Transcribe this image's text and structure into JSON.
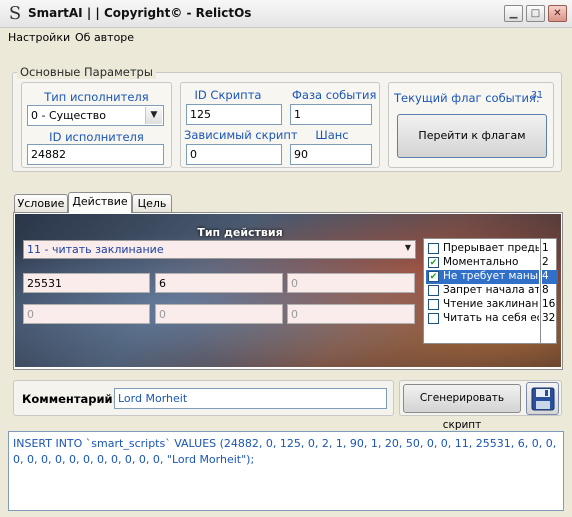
{
  "window": {
    "app_icon": "S",
    "title": "SmartAI | | Copyright© - RelictOs",
    "minimize": "▁",
    "maximize": "□",
    "close": "✕"
  },
  "menu": {
    "settings": "Настройки",
    "about": "Об авторе"
  },
  "basic_params": {
    "group_title": "Основные Параметры",
    "executor_type_label": "Тип исполнителя",
    "executor_type_value": "0 - Существо",
    "executor_id_label": "ID исполнителя",
    "executor_id_value": "24882",
    "script_id_label": "ID Скрипта",
    "script_id_value": "125",
    "event_phase_label": "Фаза события",
    "event_phase_value": "1",
    "dependent_script_label": "Зависимый скрипт",
    "dependent_script_value": "0",
    "chance_label": "Шанс",
    "chance_value": "90",
    "current_flag_label": "Текущий флаг события:",
    "current_flag_value": "31",
    "go_to_flags_button": "Перейти к флагам"
  },
  "tabs": {
    "condition": "Условие",
    "action": "Действие",
    "target": "Цель"
  },
  "action_tab": {
    "action_type_title": "Тип действия",
    "action_type_value": "11 - читать заклинание",
    "params": [
      "25531",
      "6",
      "0",
      "0",
      "0",
      "0"
    ],
    "flags": [
      {
        "label": "Прерывает преды",
        "value": "1",
        "checked": false,
        "selected": false
      },
      {
        "label": "Моментально",
        "value": "2",
        "checked": true,
        "selected": false
      },
      {
        "label": "Не требует маны",
        "value": "4",
        "checked": true,
        "selected": true
      },
      {
        "label": "Запрет начала ата",
        "value": "8",
        "checked": false,
        "selected": false
      },
      {
        "label": "Чтение заклинани",
        "value": "16",
        "checked": false,
        "selected": false
      },
      {
        "label": "Читать на себя ес",
        "value": "32",
        "checked": false,
        "selected": false
      }
    ]
  },
  "comment": {
    "label": "Комментарий:",
    "value": "Lord Morheit",
    "generate_button": "Сгенерировать скрипт",
    "save_icon": "floppy-disk"
  },
  "sql_output": "INSERT INTO `smart_scripts` VALUES (24882, 0, 125, 0, 2, 1, 90, 1, 20, 50, 0, 0, 11, 25531, 6, 0, 0, 0, 0, 0, 0, 0, 0, 0, 0, 0, 0, 0, \"Lord Morheit\");"
}
